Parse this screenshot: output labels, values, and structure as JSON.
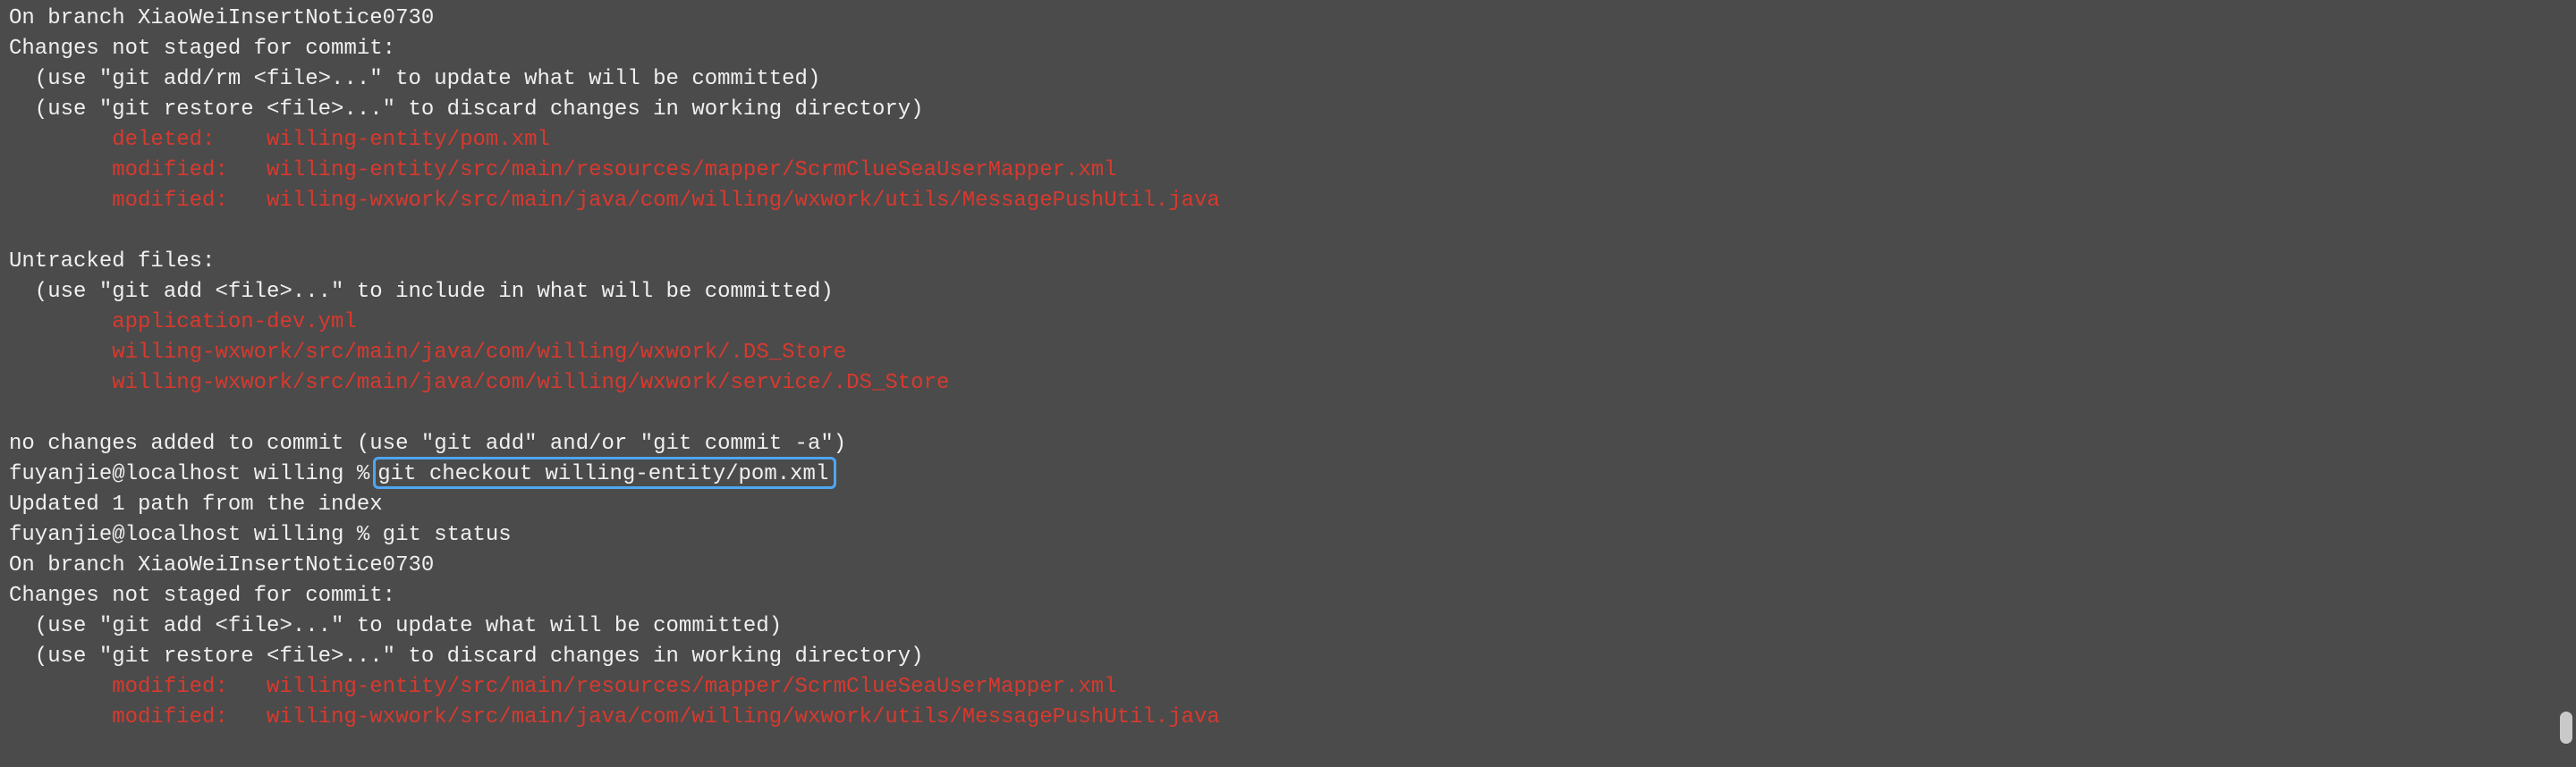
{
  "terminal": {
    "lines": [
      {
        "text": "On branch XiaoWeiInsertNotice0730",
        "color": "default"
      },
      {
        "text": "Changes not staged for commit:",
        "color": "default"
      },
      {
        "text": "  (use \"git add/rm <file>...\" to update what will be committed)",
        "color": "default"
      },
      {
        "text": "  (use \"git restore <file>...\" to discard changes in working directory)",
        "color": "default"
      },
      {
        "text": "        deleted:    willing-entity/pom.xml",
        "color": "red"
      },
      {
        "text": "        modified:   willing-entity/src/main/resources/mapper/ScrmClueSeaUserMapper.xml",
        "color": "red"
      },
      {
        "text": "        modified:   willing-wxwork/src/main/java/com/willing/wxwork/utils/MessagePushUtil.java",
        "color": "red"
      },
      {
        "text": "",
        "color": "default"
      },
      {
        "text": "Untracked files:",
        "color": "default"
      },
      {
        "text": "  (use \"git add <file>...\" to include in what will be committed)",
        "color": "default"
      },
      {
        "text": "        application-dev.yml",
        "color": "red"
      },
      {
        "text": "        willing-wxwork/src/main/java/com/willing/wxwork/.DS_Store",
        "color": "red"
      },
      {
        "text": "        willing-wxwork/src/main/java/com/willing/wxwork/service/.DS_Store",
        "color": "red"
      },
      {
        "text": "",
        "color": "default"
      },
      {
        "text": "no changes added to commit (use \"git add\" and/or \"git commit -a\")",
        "color": "default"
      }
    ],
    "highlighted_prompt": {
      "prompt": "fuyanjie@localhost willing %",
      "command": "git checkout willing-entity/pom.xml"
    },
    "after_lines": [
      {
        "text": "Updated 1 path from the index",
        "color": "default"
      },
      {
        "text": "fuyanjie@localhost willing % git status",
        "color": "default"
      },
      {
        "text": "On branch XiaoWeiInsertNotice0730",
        "color": "default"
      },
      {
        "text": "Changes not staged for commit:",
        "color": "default"
      },
      {
        "text": "  (use \"git add <file>...\" to update what will be committed)",
        "color": "default"
      },
      {
        "text": "  (use \"git restore <file>...\" to discard changes in working directory)",
        "color": "default"
      },
      {
        "text": "        modified:   willing-entity/src/main/resources/mapper/ScrmClueSeaUserMapper.xml",
        "color": "red"
      },
      {
        "text": "        modified:   willing-wxwork/src/main/java/com/willing/wxwork/utils/MessagePushUtil.java",
        "color": "red"
      }
    ]
  },
  "colors": {
    "background": "#4b4b4b",
    "text": "#f0f0f0",
    "red": "#d8392e",
    "highlight_border": "#4ea6f0"
  }
}
